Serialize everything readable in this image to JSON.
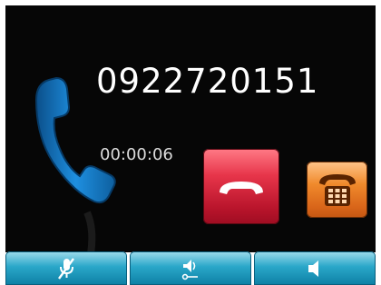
{
  "call": {
    "number": "0922720151",
    "duration": "00:00:06"
  },
  "icons": {
    "handset": "phone-handset-icon",
    "end_call": "hang-up-icon",
    "keypad": "dialpad-phone-icon",
    "mute": "mute-microphone-icon",
    "volume": "speaker-volume-icon",
    "speaker": "speaker-icon"
  },
  "colors": {
    "end_call": "#e7354a",
    "keypad": "#f08a2c",
    "toolbar": "#2aa7c9",
    "handset": "#1e88d6"
  }
}
